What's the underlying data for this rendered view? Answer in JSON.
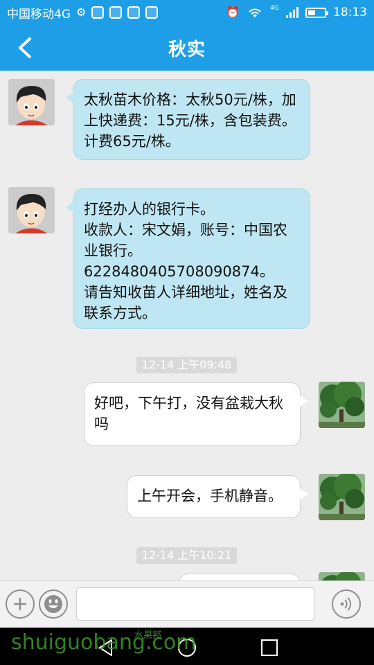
{
  "status_bar": {
    "carrier": "中国移动4G",
    "network": "4G",
    "time": "18:13"
  },
  "header": {
    "title": "秋实"
  },
  "messages": [
    {
      "direction": "incoming",
      "text": "太秋苗木价格：太秋50元/株，加上快递费：15元/株，含包装费。计费65元/株。"
    },
    {
      "direction": "incoming",
      "text": "打经办人的银行卡。\n收款人：宋文娟，账号：中国农业银行。\n6228480405708090874。\n请告知收苗人详细地址，姓名及联系方式。"
    },
    {
      "direction": "timestamp",
      "text": "12-14 上午09:48"
    },
    {
      "direction": "outgoing",
      "text": "好吧，下午打，没有盆栽大秋吗"
    },
    {
      "direction": "outgoing",
      "text": "上午开会，手机静音。"
    },
    {
      "direction": "timestamp",
      "text": "12-14 上午10:21"
    }
  ],
  "input_bar": {
    "placeholder": ""
  },
  "watermark": {
    "text": "shuiguobang.com",
    "cn": "水果邦"
  }
}
